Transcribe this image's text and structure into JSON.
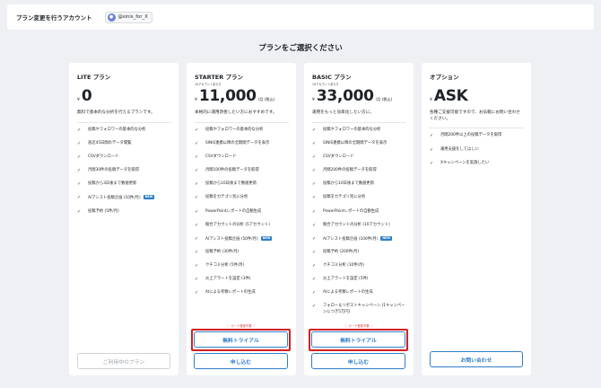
{
  "header": {
    "label": "プラン変更を行うアカウント",
    "account": "@sinis_for_X",
    "avatar_icon": "user-avatar-icon"
  },
  "page_title": "プランをご選択ください",
  "colors": {
    "accent": "#2f7fc8",
    "highlight": "#d32020",
    "badge": "#2f7fc8"
  },
  "plans": [
    {
      "name": "LITE プラン",
      "unit_note": "",
      "yen": "¥",
      "price": "0",
      "price_suffix": "",
      "description": "無料で基本的な分析を行えるプランです。",
      "features": [
        {
          "text": "投稿やフォロワーの基本的な分析"
        },
        {
          "text": "直近45日間のデータ閲覧"
        },
        {
          "text": "CSVダウンロード"
        },
        {
          "text": "月間30件の投稿データを取得"
        },
        {
          "text": "投稿から3日後まで数値更新"
        },
        {
          "text": "AIアシスト投稿企画 (10件/月)",
          "badge": "NEW"
        },
        {
          "text": "投稿予約 (5件/月)"
        }
      ],
      "buttons": {
        "current": "ご利用中のプラン"
      }
    },
    {
      "name": "STARTER プラン",
      "unit_note": "1Xアカウントあたり",
      "yen": "¥",
      "price": "11,000",
      "price_suffix": "/月 (税込)",
      "description": "本格的に運用改善したい方におすすめです。",
      "features": [
        {
          "text": "投稿やフォロワーの基本的な分析"
        },
        {
          "text": "SINIS連携以降の全期間データを表示"
        },
        {
          "text": "CSVダウンロード"
        },
        {
          "text": "月間100件の投稿データを取得"
        },
        {
          "text": "投稿から10日後まで数値更新"
        },
        {
          "text": "投稿をカテゴリ別に分析"
        },
        {
          "text": "PowerPointレポートの自動生成"
        },
        {
          "text": "競合アカウントの分析 (5アカウント)"
        },
        {
          "text": "AIアシスト投稿企画 (50件/月)",
          "badge": "NEW"
        },
        {
          "text": "投稿予約 (30件/月)"
        },
        {
          "text": "クチコミ分析 (5件/月)"
        },
        {
          "text": "炎上アラートを設定 (3件)"
        },
        {
          "text": "AIによる考察レポートの生成"
        }
      ],
      "trial_note": "＼ カード登録不要 ／",
      "buttons": {
        "trial": "無料トライアル",
        "apply": "申し込む"
      }
    },
    {
      "name": "BASIC プラン",
      "unit_note": "1Xアカウントあたり",
      "yen": "¥",
      "price": "33,000",
      "price_suffix": "/月 (税込)",
      "description": "運用をもっと効率化したい方に。",
      "features": [
        {
          "text": "投稿やフォロワーの基本的な分析"
        },
        {
          "text": "SINIS連携以降の全期間データを表示"
        },
        {
          "text": "CSVダウンロード"
        },
        {
          "text": "月間200件の投稿データを取得"
        },
        {
          "text": "投稿から10日後まで数値更新"
        },
        {
          "text": "投稿をカテゴリ別に分析"
        },
        {
          "text": "PowerPointレポートの自動生成"
        },
        {
          "text": "競合アカウントの分析 (10アカウント)"
        },
        {
          "text": "AIアシスト投稿企画 (100件/月)",
          "badge": "NEW"
        },
        {
          "text": "投稿予約 (200件/月)"
        },
        {
          "text": "クチコミ分析 (10件/月)"
        },
        {
          "text": "炎上アラートを設定 (5件)"
        },
        {
          "text": "AIによる考察レポートの生成"
        },
        {
          "text": "フォロー＆リポストキャンペーン (1キャンペーンにつき5万円)"
        }
      ],
      "trial_note": "＼ カード登録不要 ／",
      "buttons": {
        "trial": "無料トライアル",
        "apply": "申し込む"
      }
    },
    {
      "name": "オプション",
      "unit_note": "",
      "yen": "¥",
      "price": "ASK",
      "price_suffix": "",
      "description": "各種ご支援可能ですので、お気軽にお問い合わせください。",
      "features": [
        {
          "text": "月間200件以上の投稿データを取得"
        },
        {
          "text": "運用支援をしてほしい"
        },
        {
          "text": "Xキャンペーンを実施したい"
        }
      ],
      "buttons": {
        "contact": "お問い合わせ"
      }
    }
  ]
}
